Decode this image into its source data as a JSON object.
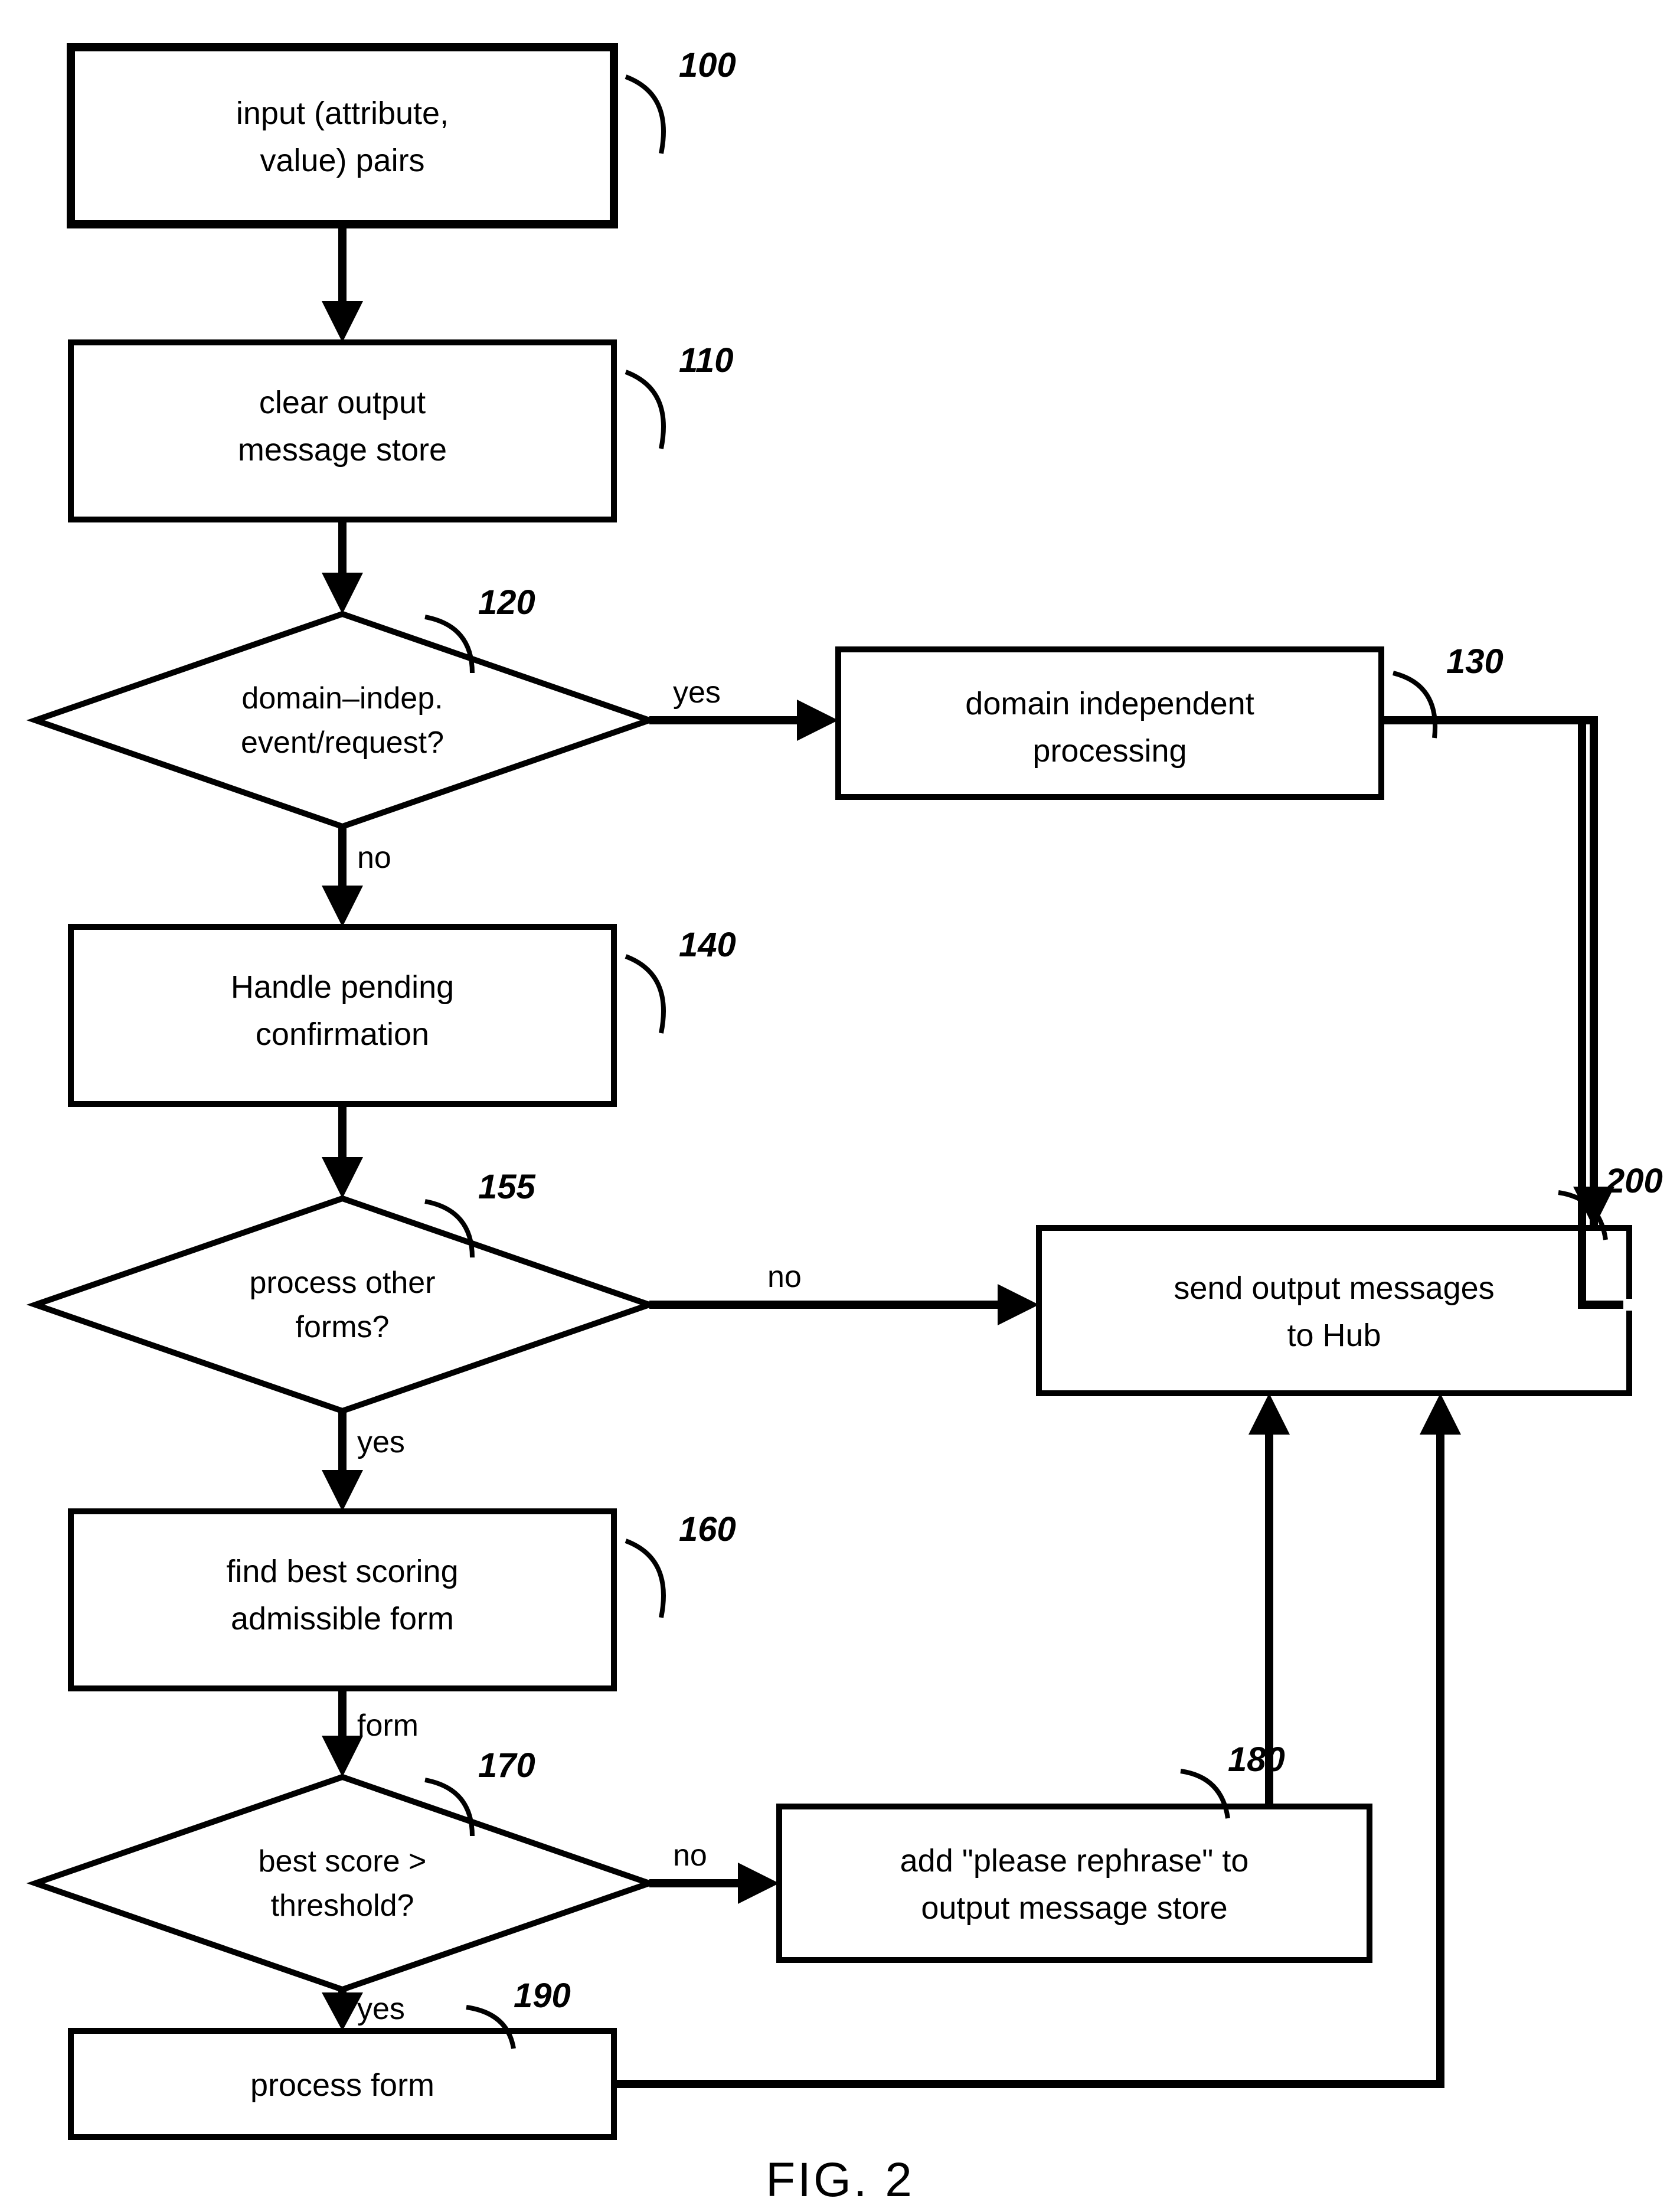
{
  "figure_label": "FIG. 2",
  "nodes": {
    "n100": {
      "ref": "100",
      "lines": [
        "input (attribute,",
        "value) pairs"
      ]
    },
    "n110": {
      "ref": "110",
      "lines": [
        "clear output",
        "message store"
      ]
    },
    "n120": {
      "ref": "120",
      "lines": [
        "domain–indep.",
        "event/request?"
      ]
    },
    "n130": {
      "ref": "130",
      "lines": [
        "domain independent",
        "processing"
      ]
    },
    "n140": {
      "ref": "140",
      "lines": [
        "Handle pending",
        "confirmation"
      ]
    },
    "n155": {
      "ref": "155",
      "lines": [
        "process other",
        "forms?"
      ]
    },
    "n160": {
      "ref": "160",
      "lines": [
        "find best scoring",
        "admissible form"
      ]
    },
    "n170": {
      "ref": "170",
      "lines": [
        "best score >",
        "threshold?"
      ]
    },
    "n180": {
      "ref": "180",
      "lines": [
        "add \"please rephrase\" to",
        "output message store"
      ]
    },
    "n190": {
      "ref": "190",
      "lines": [
        "process form"
      ]
    },
    "n200": {
      "ref": "200",
      "lines": [
        "send output messages",
        "to Hub"
      ]
    }
  },
  "edge_labels": {
    "e120_yes": "yes",
    "e120_no": "no",
    "e155_no": "no",
    "e155_yes": "yes",
    "e170_no": "no",
    "e170_yes": "yes",
    "e160_form": "form"
  }
}
